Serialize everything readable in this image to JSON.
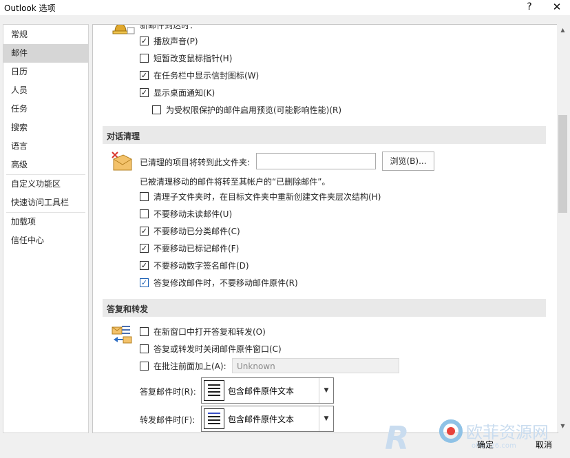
{
  "window": {
    "title": "Outlook 选项",
    "help_label": "?",
    "close_label": "✕"
  },
  "sidebar": {
    "items": [
      {
        "label": "常规"
      },
      {
        "label": "邮件"
      },
      {
        "label": "日历"
      },
      {
        "label": "人员"
      },
      {
        "label": "任务"
      },
      {
        "label": "搜索"
      },
      {
        "label": "语言"
      },
      {
        "label": "高级"
      },
      {
        "label": "自定义功能区"
      },
      {
        "label": "快速访问工具栏"
      },
      {
        "label": "加载项"
      },
      {
        "label": "信任中心"
      }
    ],
    "selected": "邮件"
  },
  "message_arrival": {
    "heading_partial": "新邮件到达时：",
    "options": [
      {
        "label": "播放声音(P)",
        "checked": true
      },
      {
        "label": "短暂改变鼠标指针(H)",
        "checked": false
      },
      {
        "label": "在任务栏中显示信封图标(W)",
        "checked": true
      },
      {
        "label": "显示桌面通知(K)",
        "checked": true
      },
      {
        "label": "为受权限保护的邮件启用预览(可能影响性能)(R)",
        "checked": false
      }
    ]
  },
  "conversation_cleanup": {
    "title": "对话清理",
    "folder_label": "已清理的项目将转到此文件夹:",
    "folder_value": "",
    "browse_label": "浏览(B)...",
    "note": "已被清理移动的邮件将转至其帐户的“已删除邮件”。",
    "options": [
      {
        "label": "清理子文件夹时，在目标文件夹中重新创建文件夹层次结构(H)",
        "checked": false
      },
      {
        "label": "不要移动未读邮件(U)",
        "checked": false
      },
      {
        "label": "不要移动已分类邮件(C)",
        "checked": true
      },
      {
        "label": "不要移动已标记邮件(F)",
        "checked": true
      },
      {
        "label": "不要移动数字签名邮件(D)",
        "checked": true
      },
      {
        "label": "答复修改邮件时，不要移动邮件原件(R)",
        "checked": true
      }
    ]
  },
  "replies_forwards": {
    "title": "答复和转发",
    "options": [
      {
        "label": "在新窗口中打开答复和转发(O)",
        "checked": false
      },
      {
        "label": "答复或转发时关闭邮件原件窗口(C)",
        "checked": false
      },
      {
        "label": "在批注前面加上(A):",
        "checked": false
      }
    ],
    "prefix_value": "Unknown",
    "reply_label": "答复邮件时(R):",
    "reply_value": "包含邮件原件文本",
    "forward_label": "转发邮件时(F):",
    "forward_value": "包含邮件原件文本"
  },
  "footer": {
    "ok_label": "确定",
    "cancel_label": "取消"
  },
  "watermark": {
    "text": "欧菲资源网",
    "sub": "office26.com"
  }
}
